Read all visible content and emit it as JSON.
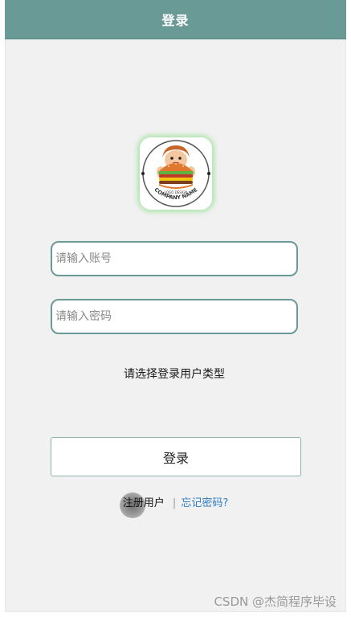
{
  "header": {
    "title": "登录"
  },
  "logo": {
    "tag_text": "LOGO DESIGN",
    "name_text": "COMPANY NAME"
  },
  "form": {
    "account_placeholder": "请输入账号",
    "password_placeholder": "请输入密码",
    "usertype_label": "请选择登录用户类型",
    "login_label": "登录"
  },
  "links": {
    "register_label": "注册用户",
    "separator": "|",
    "forgot_label": "忘记密码?"
  },
  "watermark": "CSDN @杰简程序毕设",
  "colors": {
    "header_bg": "#6a9a96",
    "field_border": "#6a9a96",
    "link_blue": "#2f7dc8",
    "logo_glow": "#78dc78"
  }
}
